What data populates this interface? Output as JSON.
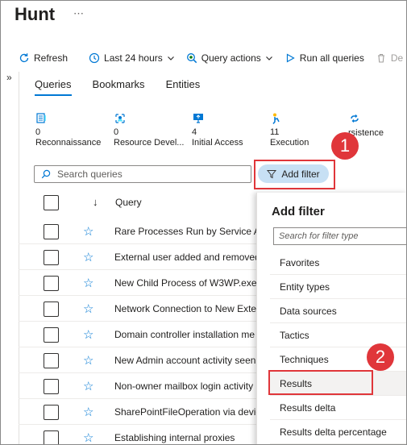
{
  "header": {
    "title": "Hunt",
    "more": "⋯"
  },
  "toolbar": {
    "refresh": "Refresh",
    "time_range": "Last 24 hours",
    "query_actions": "Query actions",
    "run_all": "Run all queries",
    "delete": "De"
  },
  "collapse_glyph": "»",
  "tabs": [
    "Queries",
    "Bookmarks",
    "Entities"
  ],
  "tactics": [
    {
      "count": "0",
      "label": "Reconnaissance",
      "icon": "reconnaissance-icon"
    },
    {
      "count": "0",
      "label": "Resource Devel...",
      "icon": "resource-development-icon"
    },
    {
      "count": "4",
      "label": "Initial Access",
      "icon": "initial-access-icon"
    },
    {
      "count": "11",
      "label": "Execution",
      "icon": "execution-icon"
    },
    {
      "count": "",
      "label": "rsistence",
      "icon": "persistence-icon"
    }
  ],
  "search": {
    "placeholder": "Search queries"
  },
  "add_filter": {
    "label": "Add filter"
  },
  "badges": {
    "one": "1",
    "two": "2"
  },
  "table": {
    "sort_glyph": "↓",
    "column_query": "Query",
    "rows": [
      "Rare Processes Run by Service Acco",
      "External user added and removed",
      "New Child Process of W3WP.exe",
      "Network Connection to New Exter",
      "Domain controller installation me",
      "New Admin account activity seen",
      "Non-owner mailbox login activity",
      "SharePointFileOperation via devic",
      "Establishing internal proxies"
    ]
  },
  "filter_panel": {
    "title": "Add filter",
    "search_placeholder": "Search for filter type",
    "options": [
      "Favorites",
      "Entity types",
      "Data sources",
      "Tactics",
      "Techniques",
      "Results",
      "Results delta",
      "Results delta percentage"
    ]
  },
  "colors": {
    "accent": "#0078d4",
    "highlight": "#e0363a",
    "chip": "#c7e0f4"
  }
}
